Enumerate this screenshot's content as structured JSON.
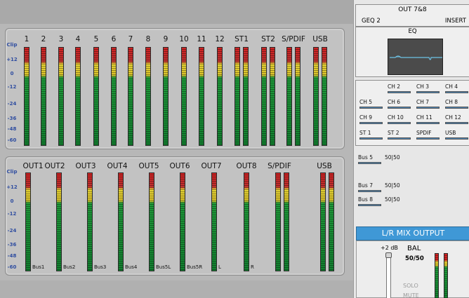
{
  "scale_labels": [
    "Clip",
    "+12",
    "0",
    "-12",
    "-24",
    "-36",
    "-48",
    "-60"
  ],
  "inputs": {
    "channels": [
      "1",
      "2",
      "3",
      "4",
      "5",
      "6",
      "7",
      "8",
      "9",
      "10",
      "11",
      "12",
      "ST1",
      "ST2",
      "S/PDIF",
      "USB"
    ]
  },
  "outputs": {
    "channels": [
      "OUT1",
      "OUT2",
      "OUT3",
      "OUT4",
      "OUT5",
      "OUT6",
      "OUT7",
      "OUT8",
      "S/PDIF",
      "USB"
    ],
    "bus_labels": [
      "Bus1",
      "Bus2",
      "Bus3",
      "Bus4",
      "Bus5L",
      "Bus5R",
      "L",
      "R"
    ]
  },
  "side": {
    "out78": {
      "title": "OUT 7&8",
      "left": "GEQ 2",
      "right": "INSERT"
    },
    "eq_title": "EQ",
    "sends": [
      [
        "",
        "CH 2",
        "CH 3",
        "CH 4"
      ],
      [
        "CH 5",
        "CH 6",
        "CH 7",
        "CH 8"
      ],
      [
        "CH 9",
        "CH 10",
        "CH 11",
        "CH 12"
      ],
      [
        "ST 1",
        "ST 2",
        "SPDIF",
        "USB"
      ]
    ],
    "buses": [
      {
        "name": "Bus 5",
        "bal": "50|50"
      },
      {
        "name": "Bus 7",
        "bal": "50|50"
      },
      {
        "name": "Bus 8",
        "bal": "50|50"
      }
    ],
    "lr": {
      "title": "L/R MIX OUTPUT",
      "gain": "+2 dB",
      "bal_label": "BAL",
      "bal_value": "50/50",
      "solo": "SOLO",
      "mute": "MUTE"
    }
  },
  "colors": {
    "lr_header": "#3f98d6",
    "eq_curve": "#6ec3e6",
    "meter_red": "#cf2323",
    "meter_yellow": "#e5d334",
    "meter_green": "#1f9a3a"
  }
}
